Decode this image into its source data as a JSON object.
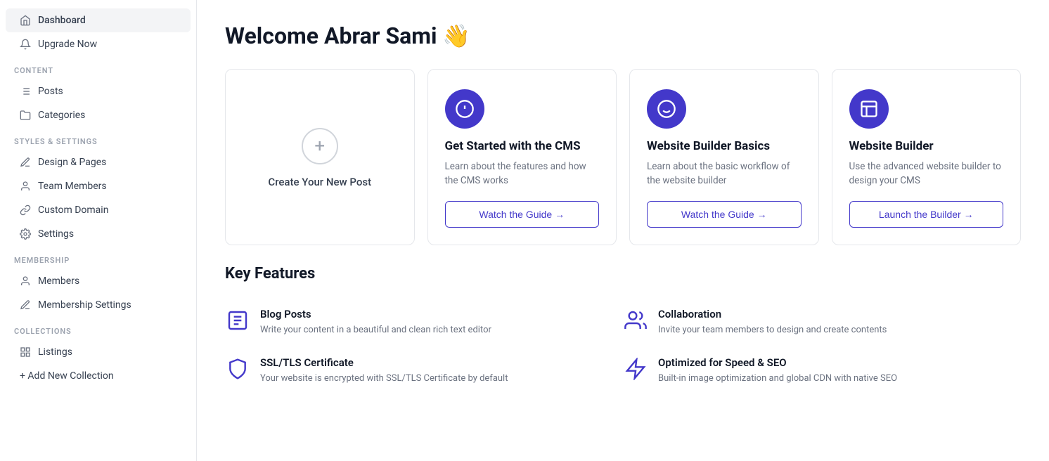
{
  "sidebar": {
    "nav_items": [
      {
        "id": "dashboard",
        "label": "Dashboard",
        "icon": "home",
        "active": true
      },
      {
        "id": "upgrade",
        "label": "Upgrade Now",
        "icon": "bell",
        "active": false
      }
    ],
    "sections": [
      {
        "id": "content",
        "label": "CONTENT",
        "items": [
          {
            "id": "posts",
            "label": "Posts",
            "icon": "list"
          },
          {
            "id": "categories",
            "label": "Categories",
            "icon": "folder"
          }
        ]
      },
      {
        "id": "styles",
        "label": "STYLES & SETTINGS",
        "items": [
          {
            "id": "design",
            "label": "Design & Pages",
            "icon": "edit"
          },
          {
            "id": "team",
            "label": "Team Members",
            "icon": "user"
          },
          {
            "id": "domain",
            "label": "Custom Domain",
            "icon": "link"
          },
          {
            "id": "settings",
            "label": "Settings",
            "icon": "gear"
          }
        ]
      },
      {
        "id": "membership",
        "label": "MEMBERSHIP",
        "items": [
          {
            "id": "members",
            "label": "Members",
            "icon": "user"
          },
          {
            "id": "membership_settings",
            "label": "Membership Settings",
            "icon": "edit"
          }
        ]
      },
      {
        "id": "collections",
        "label": "COLLECTIONS",
        "items": [
          {
            "id": "listings",
            "label": "Listings",
            "icon": "grid"
          }
        ]
      }
    ],
    "add_collection_label": "+ Add New Collection"
  },
  "main": {
    "welcome_title": "Welcome Abrar Sami 👋",
    "cards": [
      {
        "id": "create_post",
        "type": "create",
        "label": "Create Your New Post"
      },
      {
        "id": "get_started",
        "type": "guide",
        "title": "Get Started with the CMS",
        "desc": "Learn about the features and how the CMS works",
        "btn_label": "Watch the Guide →"
      },
      {
        "id": "builder_basics",
        "type": "guide",
        "title": "Website Builder Basics",
        "desc": "Learn about the basic workflow of the website builder",
        "btn_label": "Watch the Guide →"
      },
      {
        "id": "website_builder",
        "type": "launch",
        "title": "Website Builder",
        "desc": "Use the advanced website builder to design your CMS",
        "btn_label": "Launch the Builder →"
      }
    ],
    "key_features": {
      "title": "Key Features",
      "items": [
        {
          "id": "blog_posts",
          "title": "Blog Posts",
          "desc": "Write your content in a beautiful and clean rich text editor",
          "icon": "edit-square"
        },
        {
          "id": "collaboration",
          "title": "Collaboration",
          "desc": "Invite your team members to design and create contents",
          "icon": "team"
        },
        {
          "id": "ssl",
          "title": "SSL/TLS Certificate",
          "desc": "Your website is encrypted with SSL/TLS Certificate by default",
          "icon": "shield"
        },
        {
          "id": "speed_seo",
          "title": "Optimized for Speed & SEO",
          "desc": "Built-in image optimization and global CDN with native SEO",
          "icon": "lightning"
        }
      ]
    }
  },
  "colors": {
    "accent": "#4338ca",
    "accent_light": "#eef2ff"
  }
}
